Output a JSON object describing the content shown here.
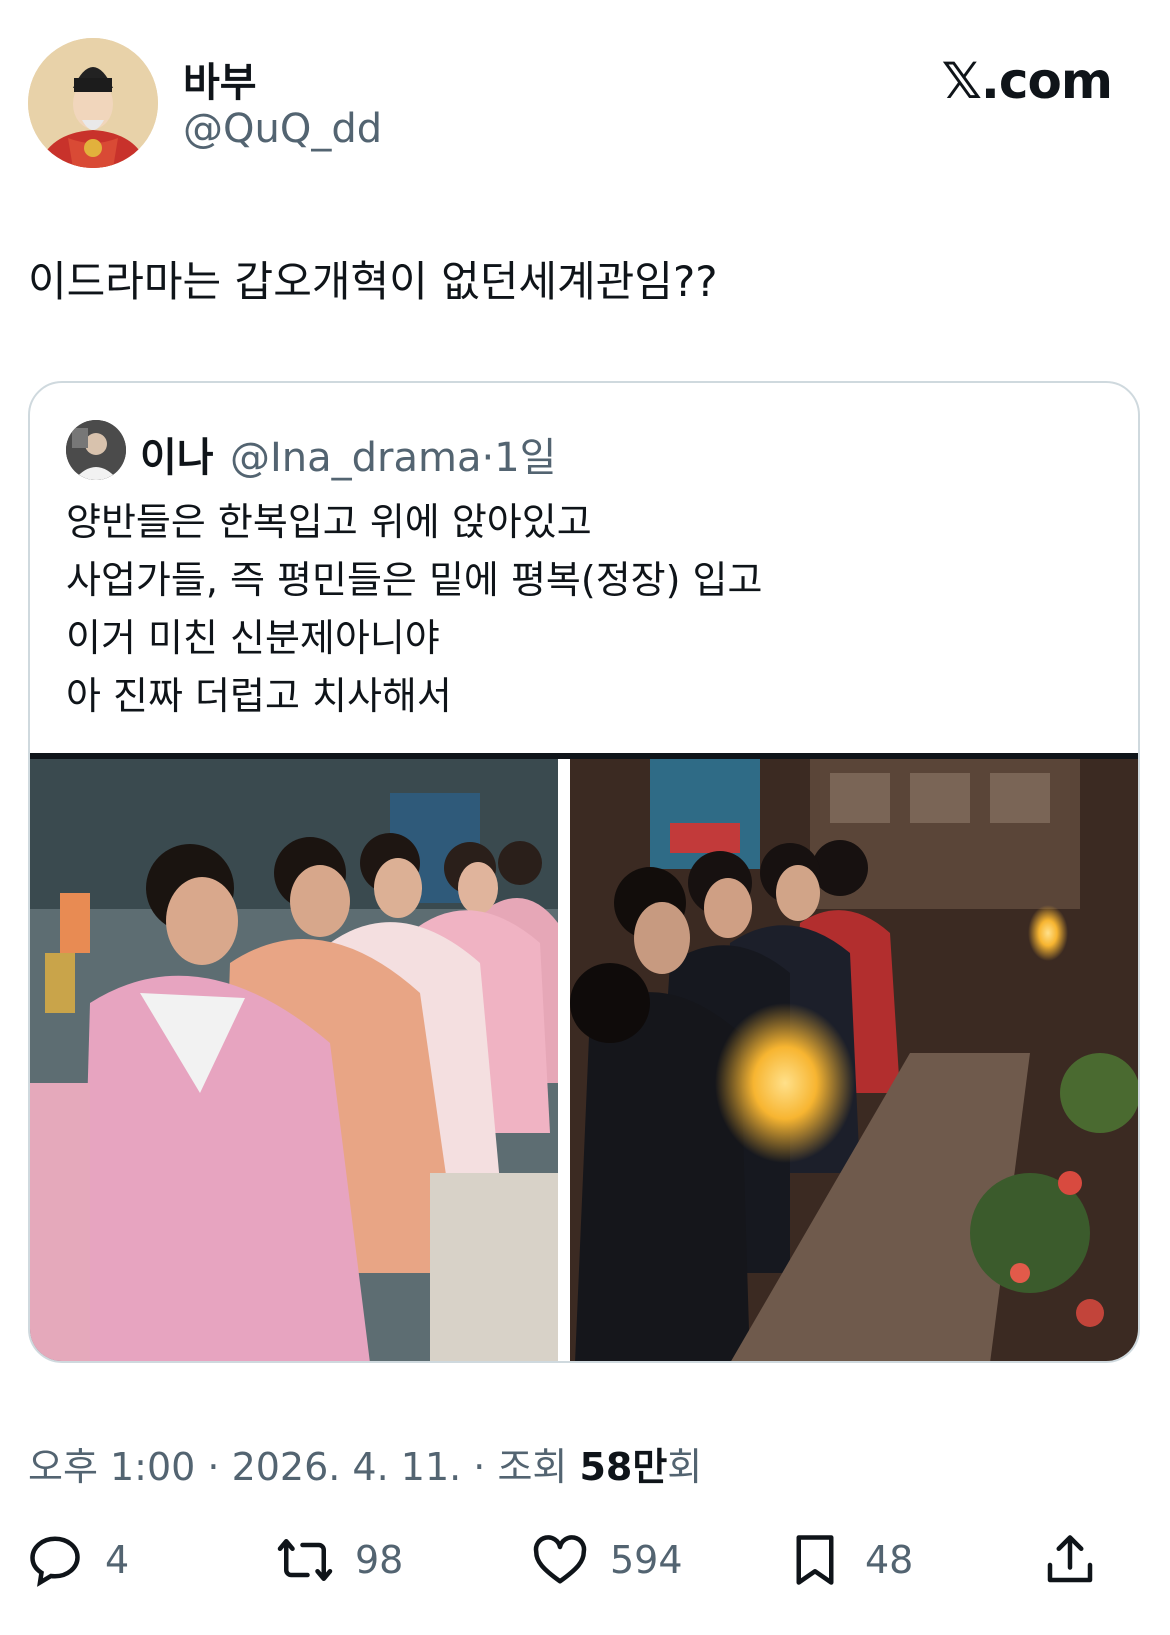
{
  "author": {
    "display_name": "바부",
    "handle": "@QuQ_dd",
    "avatar_icon": "king-portrait-avatar"
  },
  "brand": "𝕏.com",
  "tweet": {
    "text": "이드라마는 갑오개혁이 없던세계관임??"
  },
  "quote": {
    "display_name": "이나",
    "handle": "@Ina_drama",
    "separator": "·",
    "age": "1일",
    "lines": [
      "양반들은 한복입고 위에 앉아있고",
      "사업가들, 즉 평민들은 밑에 평복(정장) 입고",
      "이거 미친 신분제아니야",
      "아 진짜 더럽고 치사해서"
    ],
    "media": [
      {
        "icon": "drama-still-hanbok-men"
      },
      {
        "icon": "drama-still-suits-dinner"
      }
    ]
  },
  "meta": {
    "prefix": "오후 1:00 · 2026. 4. 11. · 조회 ",
    "views": "58만",
    "suffix": "회"
  },
  "actions": {
    "replies": "4",
    "reposts": "98",
    "likes": "594",
    "bookmarks": "48"
  },
  "colors": {
    "text": "#0f1419",
    "secondary": "#536471",
    "border": "#cfd9de"
  }
}
